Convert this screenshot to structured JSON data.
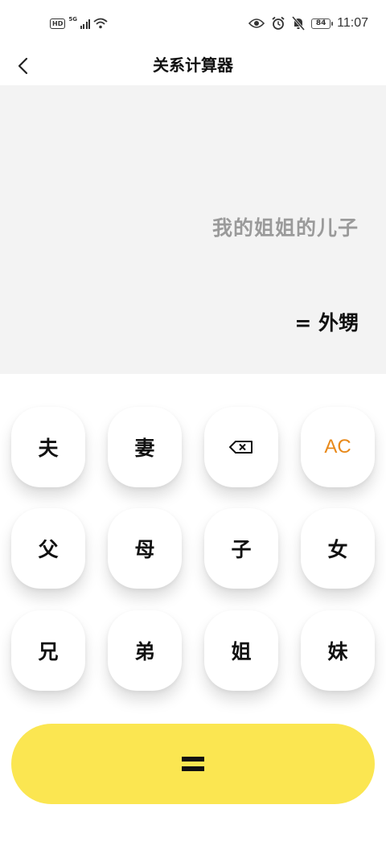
{
  "status_bar": {
    "hd_badge": "HD",
    "network": "5G",
    "battery": "84",
    "time": "11:07",
    "icons": [
      "signal-icon",
      "wifi-icon",
      "eye-icon",
      "alarm-icon",
      "mute-icon",
      "battery-icon"
    ]
  },
  "header": {
    "title": "关系计算器",
    "back_icon": "chevron-left-icon"
  },
  "display": {
    "expression": "我的姐姐的儿子",
    "result": "= 外甥"
  },
  "keypad": {
    "row1": [
      "夫",
      "妻",
      "backspace",
      "AC"
    ],
    "row2": [
      "父",
      "母",
      "子",
      "女"
    ],
    "row3": [
      "兄",
      "弟",
      "姐",
      "妹"
    ],
    "backspace_icon": "backspace-icon",
    "ac_label": "AC",
    "equals_icon": "equals-icon"
  },
  "colors": {
    "accent_yellow": "#fbe651",
    "ac_orange": "#e8891a",
    "display_bg": "#f3f3f3",
    "expression_gray": "#9a9a9a"
  }
}
